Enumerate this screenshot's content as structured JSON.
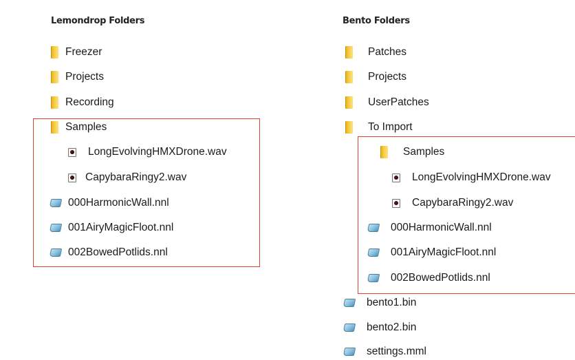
{
  "left_panel": {
    "heading": "Lemondrop Folders",
    "items": [
      {
        "label": "Freezer",
        "icon": "folder-icon"
      },
      {
        "label": "Projects",
        "icon": "folder-icon"
      },
      {
        "label": "Recording",
        "icon": "folder-icon"
      },
      {
        "label": "Samples",
        "icon": "folder-icon"
      },
      {
        "label": "LongEvolvingHMXDrone.wav",
        "icon": "wav-file-icon"
      },
      {
        "label": "CapybaraRingy2.wav",
        "icon": "wav-file-icon"
      },
      {
        "label": "000HarmonicWall.nnl",
        "icon": "nnl-file-icon"
      },
      {
        "label": "001AiryMagicFloot.nnl",
        "icon": "nnl-file-icon"
      },
      {
        "label": "002BowedPotlids.nnl",
        "icon": "nnl-file-icon"
      }
    ]
  },
  "right_panel": {
    "heading": "Bento Folders",
    "items": [
      {
        "label": "Patches",
        "icon": "folder-icon"
      },
      {
        "label": "Projects",
        "icon": "folder-icon"
      },
      {
        "label": "UserPatches",
        "icon": "folder-icon"
      },
      {
        "label": "To Import",
        "icon": "folder-icon"
      },
      {
        "label": "Samples",
        "icon": "folder-icon"
      },
      {
        "label": "LongEvolvingHMXDrone.wav",
        "icon": "wav-file-icon"
      },
      {
        "label": "CapybaraRingy2.wav",
        "icon": "wav-file-icon"
      },
      {
        "label": "000HarmonicWall.nnl",
        "icon": "nnl-file-icon"
      },
      {
        "label": "001AiryMagicFloot.nnl",
        "icon": "nnl-file-icon"
      },
      {
        "label": "002BowedPotlids.nnl",
        "icon": "nnl-file-icon"
      },
      {
        "label": "bento1.bin",
        "icon": "bin-file-icon"
      },
      {
        "label": "bento2.bin",
        "icon": "bin-file-icon"
      },
      {
        "label": "settings.mml",
        "icon": "mml-file-icon"
      }
    ]
  },
  "colors": {
    "highlight_box": "#e0402a",
    "folder": "#f2c335",
    "file": "#8fc3e0"
  }
}
